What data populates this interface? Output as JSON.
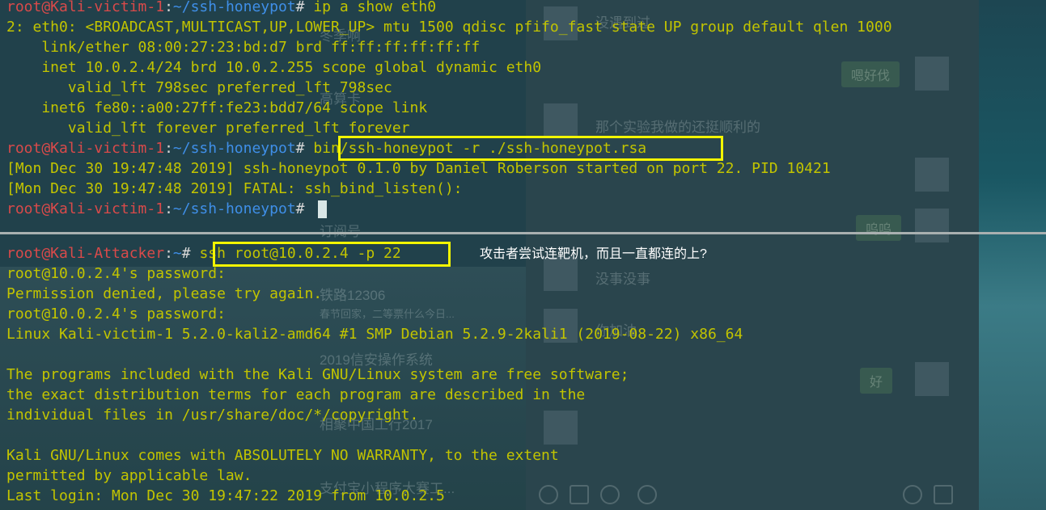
{
  "top_pane": {
    "lines": [
      {
        "prompt": {
          "user": "root@Kali-victim-1",
          "sep": ":",
          "path": "~/ssh-honeypot",
          "hash": "#"
        },
        "command": " ip a show eth0"
      },
      {
        "text": "2: eth0: <BROADCAST,MULTICAST,UP,LOWER_UP> mtu 1500 qdisc pfifo_fast state UP group default qlen 1000"
      },
      {
        "text": "    link/ether 08:00:27:23:bd:d7 brd ff:ff:ff:ff:ff:ff"
      },
      {
        "text": "    inet 10.0.2.4/24 brd 10.0.2.255 scope global dynamic eth0"
      },
      {
        "text": "       valid_lft 798sec preferred_lft 798sec"
      },
      {
        "text": "    inet6 fe80::a00:27ff:fe23:bdd7/64 scope link"
      },
      {
        "text": "       valid_lft forever preferred_lft forever"
      },
      {
        "prompt": {
          "user": "root@Kali-victim-1",
          "sep": ":",
          "path": "~/ssh-honeypot",
          "hash": "#"
        },
        "command": " bin/ssh-honeypot -r ./ssh-honeypot.rsa"
      },
      {
        "text": "[Mon Dec 30 19:47:48 2019] ssh-honeypot 0.1.0 by Daniel Roberson started on port 22. PID 10421"
      },
      {
        "text": "[Mon Dec 30 19:47:48 2019] FATAL: ssh_bind_listen():"
      },
      {
        "prompt": {
          "user": "root@Kali-victim-1",
          "sep": ":",
          "path": "~/ssh-honeypot",
          "hash": "#"
        },
        "command": " "
      }
    ]
  },
  "bottom_pane": {
    "lines": [
      {
        "prompt": {
          "user": "root@Kali-Attacker",
          "sep": ":",
          "path": "~",
          "hash": "#"
        },
        "command": " ssh root@10.0.2.4 -p 22"
      },
      {
        "text": "root@10.0.2.4's password:"
      },
      {
        "text": "Permission denied, please try again."
      },
      {
        "text": "root@10.0.2.4's password:"
      },
      {
        "text": "Linux Kali-victim-1 5.2.0-kali2-amd64 #1 SMP Debian 5.2.9-2kali1 (2019-08-22) x86_64"
      },
      {
        "text": ""
      },
      {
        "text": "The programs included with the Kali GNU/Linux system are free software;"
      },
      {
        "text": "the exact distribution terms for each program are described in the"
      },
      {
        "text": "individual files in /usr/share/doc/*/copyright."
      },
      {
        "text": ""
      },
      {
        "text": "Kali GNU/Linux comes with ABSOLUTELY NO WARRANTY, to the extent"
      },
      {
        "text": "permitted by applicable law."
      },
      {
        "text": "Last login: Mon Dec 30 19:47:22 2019 from 10.0.2.5"
      }
    ]
  },
  "annotation": "攻击者尝试连靶机，而且一直都连的上?",
  "colors": {
    "user": "#d94a4a",
    "path": "#3f8fe8",
    "output": "#c2c400",
    "highlight": "#f3f500"
  },
  "background_chat": {
    "list_items": [
      "冬季啊",
      "高算卡",
      "订阅号",
      "铁路12306",
      "春节回家，二等票什么今日...",
      "2019信安操作系统",
      "相聚中国工行2017",
      "支付宝小程序大赛工..."
    ],
    "messages": [
      "没遇到过",
      "嗯好伐",
      "那个实验我做的还挺顺利的",
      "呜呜",
      "没事没事",
      "你加油",
      "好"
    ]
  }
}
